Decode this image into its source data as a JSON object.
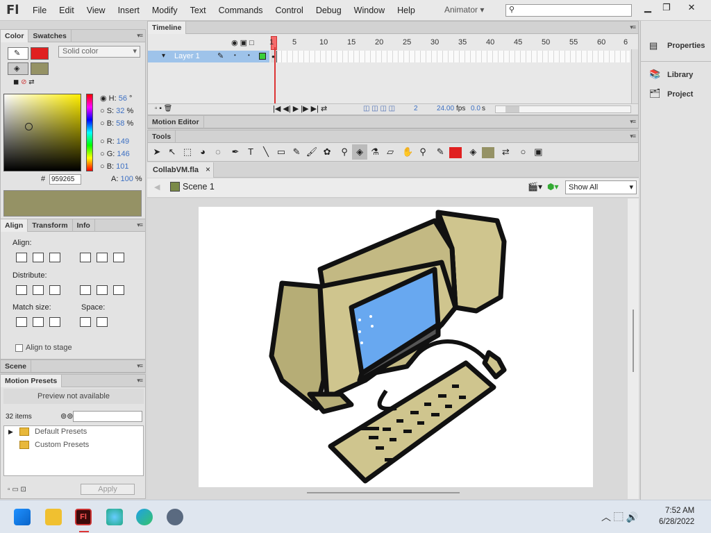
{
  "app": {
    "logo": "Fl",
    "workspace": "Animator"
  },
  "menu": [
    "File",
    "Edit",
    "View",
    "Insert",
    "Modify",
    "Text",
    "Commands",
    "Control",
    "Debug",
    "Window",
    "Help"
  ],
  "color_panel": {
    "tabs": [
      "Color",
      "Swatches"
    ],
    "fill_type": "Solid color",
    "stroke_color": "#e02020",
    "fill_color": "#959265",
    "hsb": {
      "h_label": "H:",
      "h": "56",
      "h_unit": "°",
      "s_label": "S:",
      "s": "32",
      "s_unit": "%",
      "b_label": "B:",
      "b": "58",
      "b_unit": "%"
    },
    "rgb": {
      "r_label": "R:",
      "r": "149",
      "g_label": "G:",
      "g": "146",
      "b_label": "B:",
      "b": "101"
    },
    "alpha": {
      "label": "A:",
      "value": "100",
      "unit": "%"
    },
    "hex_label": "#",
    "hex": "959265"
  },
  "align_panel": {
    "tabs": [
      "Align",
      "Transform",
      "Info"
    ],
    "align_label": "Align:",
    "distribute_label": "Distribute:",
    "match_label": "Match size:",
    "space_label": "Space:",
    "align_to_stage": "Align to stage"
  },
  "scene_panel": {
    "title": "Scene"
  },
  "motion_presets": {
    "title": "Motion Presets",
    "preview": "Preview not available",
    "count": "32 items",
    "items": [
      "Default Presets",
      "Custom Presets"
    ],
    "apply": "Apply"
  },
  "timeline": {
    "title": "Timeline",
    "layer": "Layer 1",
    "frame_numbers": [
      "1",
      "5",
      "10",
      "15",
      "20",
      "25",
      "30",
      "35",
      "40",
      "45",
      "50",
      "55",
      "60",
      "6"
    ],
    "frame": "2",
    "fps": "24.00",
    "fps_unit": "fps",
    "time": "0.0",
    "time_unit": "s"
  },
  "motion_editor": {
    "title": "Motion Editor"
  },
  "tools": {
    "title": "Tools"
  },
  "document": {
    "tab": "CollabVM.fla",
    "close": "×",
    "scene": "Scene 1",
    "zoom": "Show All"
  },
  "right_panel": {
    "items": [
      "Properties",
      "Library",
      "Project"
    ]
  },
  "taskbar": {
    "time": "7:52 AM",
    "date": "6/28/2022"
  }
}
